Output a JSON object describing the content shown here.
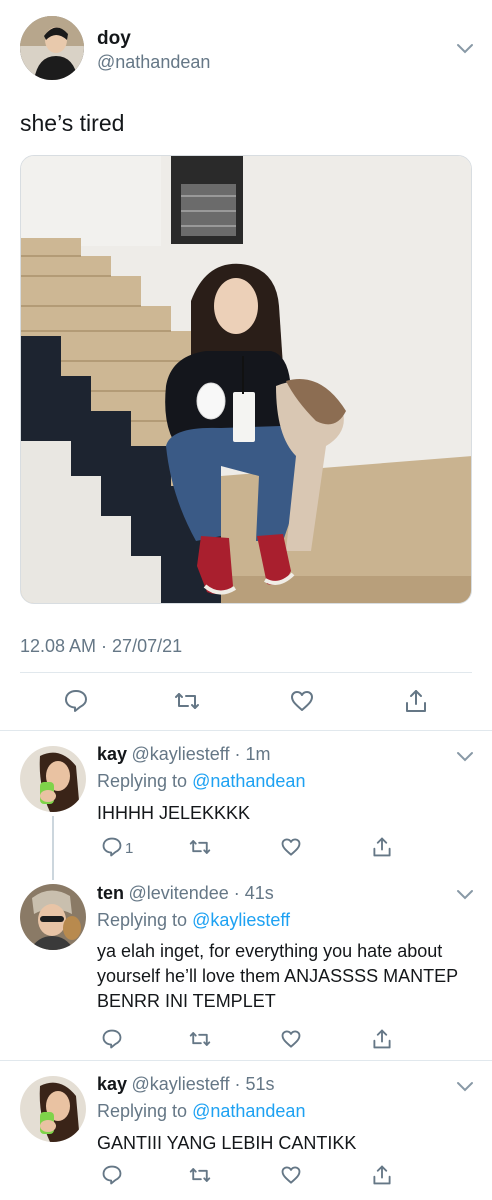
{
  "tweet": {
    "display_name": "doy",
    "handle": "@nathandean",
    "text": "she’s tired",
    "timestamp": "12.08 AM · 27/07/21",
    "actions": [
      "reply-icon",
      "retweet-icon",
      "like-icon",
      "share-icon"
    ]
  },
  "replies": [
    {
      "display_name": "kay",
      "meta": "@kayliesteff · 1m",
      "replying_prefix": "Replying to",
      "replying_to": "@nathandean",
      "text": "IHHHH JELEKKKK",
      "reply_count": "1"
    },
    {
      "display_name": "ten",
      "meta": "@levitendee · 41s",
      "replying_prefix": "Replying to",
      "replying_to": "@kayliesteff",
      "text": "ya elah inget, for everything you hate about yourself he’ll love them ANJASSSS MANTEP BENRR INI TEMPLET"
    },
    {
      "display_name": "kay",
      "meta": "@kayliesteff · 51s",
      "replying_prefix": "Replying to",
      "replying_to": "@nathandean",
      "text": "GANTIII YANG LEBIH CANTIKK"
    }
  ],
  "colors": {
    "text": "#14171a",
    "secondary": "#657786",
    "link": "#1da1f2",
    "divider": "#e1e8ed"
  }
}
